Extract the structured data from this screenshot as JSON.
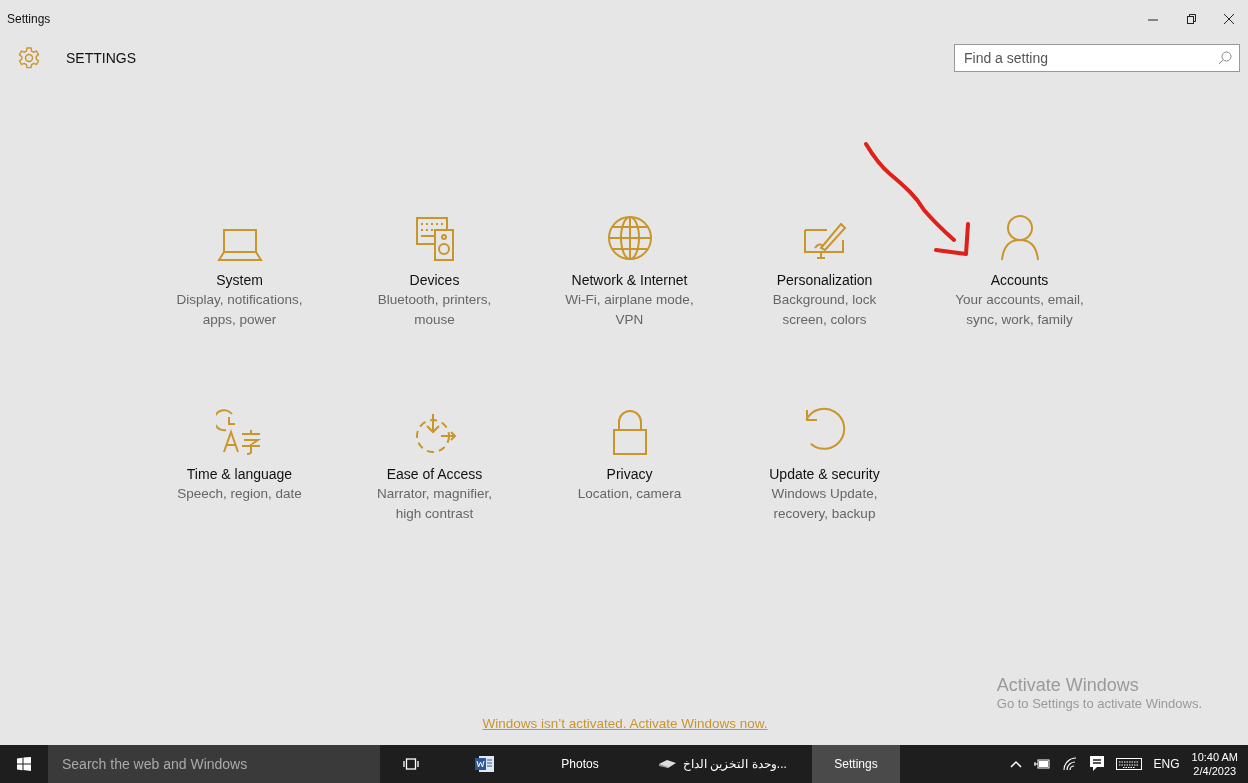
{
  "window": {
    "title": "Settings"
  },
  "header": {
    "title": "SETTINGS",
    "search": {
      "placeholder": "Find a setting"
    }
  },
  "tiles": [
    {
      "kind": "system",
      "title": "System",
      "description": "Display, notifications, apps, power"
    },
    {
      "kind": "devices",
      "title": "Devices",
      "description": "Bluetooth, printers, mouse"
    },
    {
      "kind": "network",
      "title": "Network & Internet",
      "description": "Wi-Fi, airplane mode, VPN"
    },
    {
      "kind": "personalization",
      "title": "Personalization",
      "description": "Background, lock screen, colors"
    },
    {
      "kind": "accounts",
      "title": "Accounts",
      "description": "Your accounts, email, sync, work, family"
    },
    {
      "kind": "time",
      "title": "Time & language",
      "description": "Speech, region, date"
    },
    {
      "kind": "ease",
      "title": "Ease of Access",
      "description": "Narrator, magnifier, high contrast"
    },
    {
      "kind": "privacy",
      "title": "Privacy",
      "description": "Location, camera"
    },
    {
      "kind": "update",
      "title": "Update & security",
      "description": "Windows Update, recovery, backup"
    }
  ],
  "activation_link": "Windows isn’t activated. Activate Windows now.",
  "activation_notice": {
    "title": "Activate Windows",
    "message": "Go to Settings to activate Windows."
  },
  "taskbar": {
    "search": {
      "placeholder": "Search the web and Windows"
    },
    "apps": [
      {
        "kind": "word",
        "selected": false
      },
      {
        "kind": "label",
        "label": "Photos",
        "selected": false
      },
      {
        "kind": "drive",
        "label": "...وحدة التخزين الداخ",
        "selected": false
      },
      {
        "kind": "label",
        "label": "Settings",
        "selected": true
      }
    ],
    "tray": {
      "language": "ENG",
      "time": "10:40 AM",
      "date": "2/4/2023"
    }
  }
}
